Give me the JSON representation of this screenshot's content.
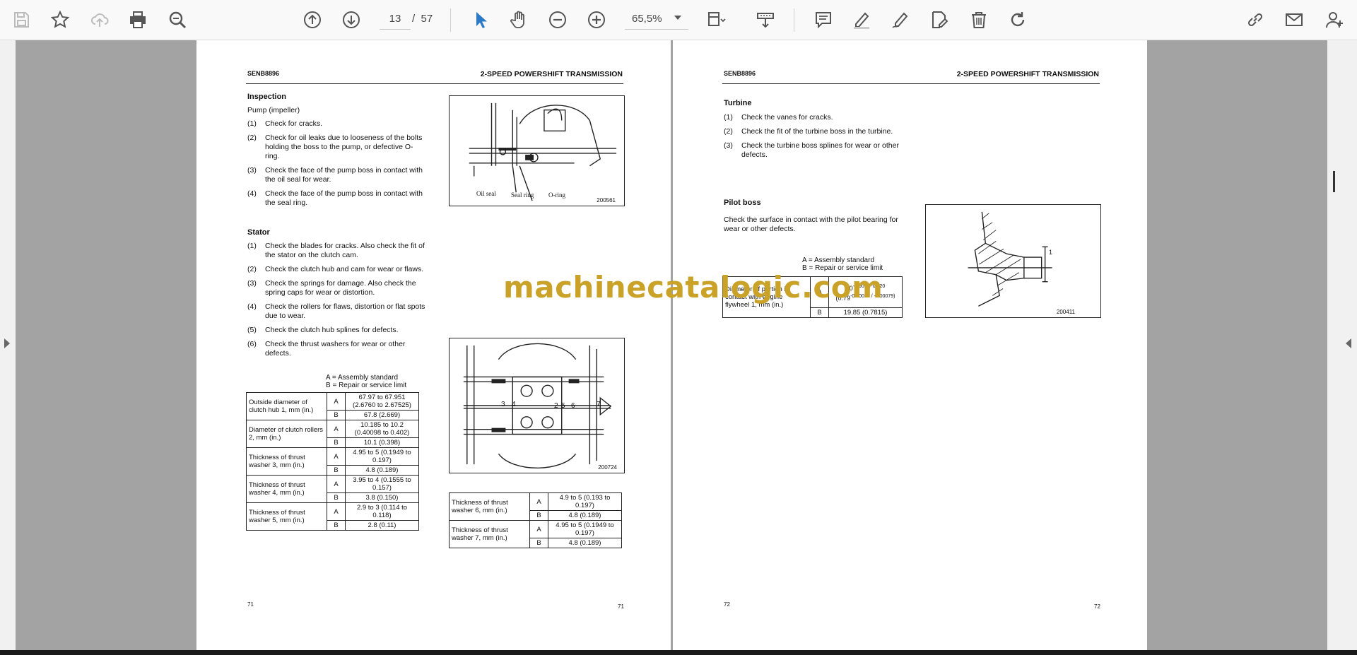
{
  "toolbar": {
    "current_page": "13",
    "page_separator": "/",
    "total_pages": "57",
    "zoom": "65,5%"
  },
  "colors": {
    "accent": "#2a7ac7",
    "watermark": "#c9a227"
  },
  "left_page": {
    "doc_code": "SENB8896",
    "header_title": "2-SPEED POWERSHIFT TRANSMISSION",
    "inspection": {
      "title": "Inspection",
      "subtitle": "Pump (impeller)",
      "items": [
        {
          "n": "(1)",
          "text": "Check for cracks."
        },
        {
          "n": "(2)",
          "text": "Check for oil leaks due to looseness of the bolts holding the boss to the pump, or defective O-ring."
        },
        {
          "n": "(3)",
          "text": "Check the face of the pump boss in contact with the oil seal for wear."
        },
        {
          "n": "(4)",
          "text": "Check the face of the pump boss in contact with the seal ring."
        }
      ]
    },
    "fig1": {
      "labels": [
        "Oil seal",
        "Seal ring",
        "O-ring"
      ],
      "number": "200561"
    },
    "stator": {
      "title": "Stator",
      "items": [
        {
          "n": "(1)",
          "text": "Check the blades for cracks. Also check the fit of the stator on the clutch cam."
        },
        {
          "n": "(2)",
          "text": "Check the clutch hub and cam for wear or flaws."
        },
        {
          "n": "(3)",
          "text": "Check the springs for damage. Also check the spring caps for wear or distortion."
        },
        {
          "n": "(4)",
          "text": "Check the rollers for flaws, distortion or flat spots due to wear."
        },
        {
          "n": "(5)",
          "text": "Check the clutch hub splines for defects."
        },
        {
          "n": "(6)",
          "text": "Check the thrust washers for wear or other defects."
        }
      ]
    },
    "legend": {
      "a": "A = Assembly standard",
      "b": "B = Repair or service limit"
    },
    "table": [
      {
        "label": "Outside diameter of clutch hub 1, mm (in.)",
        "a": "67.97 to 67.951 (2.6760 to 2.67525)",
        "b": "67.8 (2.669)"
      },
      {
        "label": "Diameter of clutch rollers 2, mm (in.)",
        "a": "10.185 to 10.2 (0.40098 to 0.402)",
        "b": "10.1 (0.398)"
      },
      {
        "label": "Thickness of thrust washer 3, mm (in.)",
        "a": "4.95 to 5 (0.1949 to 0.197)",
        "b": "4.8 (0.189)"
      },
      {
        "label": "Thickness of thrust washer 4, mm (in.)",
        "a": "3.95 to 4 (0.1555 to 0.157)",
        "b": "3.8 (0.150)"
      },
      {
        "label": "Thickness of thrust washer 5, mm (in.)",
        "a": "2.9 to 3 (0.114 to 0.118)",
        "b": "2.8 (0.11)"
      }
    ],
    "fig2": {
      "labels": [
        "3",
        "4",
        "2",
        "5",
        "6",
        "7"
      ],
      "number": "200724"
    },
    "table2": [
      {
        "label": "Thickness of thrust washer 6, mm (in.)",
        "a": "4.9 to 5 (0.193 to 0.197)",
        "b": "4.8 (0.189)"
      },
      {
        "label": "Thickness of thrust washer 7, mm (in.)",
        "a": "4.95 to 5 (0.1949 to 0.197)",
        "b": "4.8 (0.189)"
      }
    ],
    "page_num_left": "71",
    "page_num_right": "71"
  },
  "right_page": {
    "doc_code": "SENB8896",
    "header_title": "2-SPEED POWERSHIFT TRANSMISSION",
    "turbine": {
      "title": "Turbine",
      "items": [
        {
          "n": "(1)",
          "text": "Check the vanes for cracks."
        },
        {
          "n": "(2)",
          "text": "Check the fit of the turbine boss in the turbine."
        },
        {
          "n": "(3)",
          "text": "Check the turbine boss splines for wear or other defects."
        }
      ]
    },
    "pilot": {
      "title": "Pilot boss",
      "text": "Check the surface in contact with the pilot bearing for wear or other defects."
    },
    "legend": {
      "a": "A = Assembly standard",
      "b": "B = Repair or service limit"
    },
    "table": {
      "label": "Diameter of portion in contact with engine flywheel 1, mm (in.)",
      "a_main": "20",
      "a_tol": "-0.007 / -0.020",
      "a_in": "(0.79",
      "a_in_tol": "-0.00028 / -0.00079)",
      "b": "19.85 (0.7815)"
    },
    "fig": {
      "label": "1",
      "number": "200411"
    },
    "page_num_left": "72",
    "page_num_right": "72"
  },
  "watermark": "machinecatalogic.com"
}
